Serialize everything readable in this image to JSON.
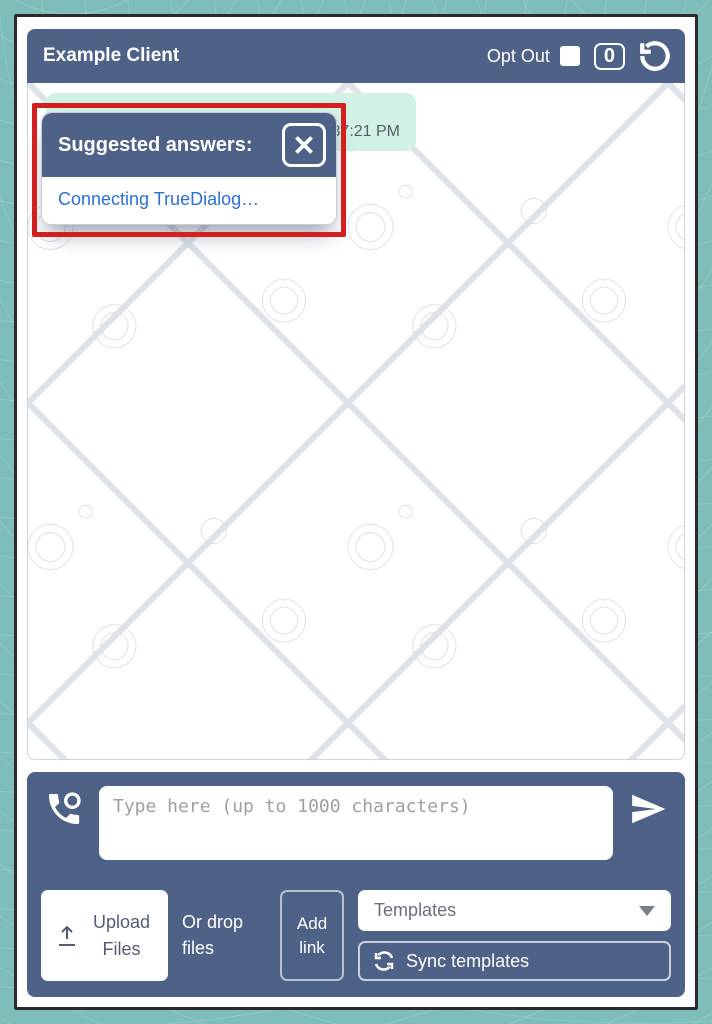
{
  "header": {
    "title": "Example Client",
    "opt_out_label": "Opt Out",
    "badge_count": "0"
  },
  "message": {
    "timestamp": "1:37:21 PM"
  },
  "popup": {
    "title": "Suggested answers:",
    "link_text": "Connecting TrueDialog…"
  },
  "composer": {
    "placeholder": "Type here (up to 1000 characters)",
    "upload_label": "Upload\nFiles",
    "drop_label": "Or drop files",
    "add_link_label": "Add link",
    "templates_label": "Templates",
    "sync_label": "Sync templates"
  }
}
